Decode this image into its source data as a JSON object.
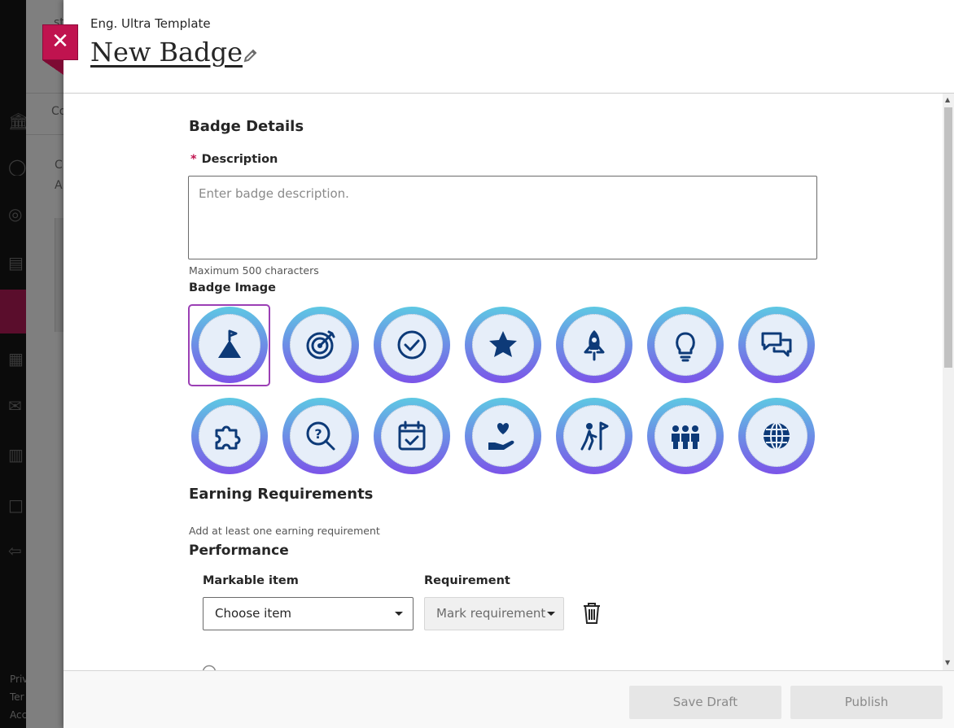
{
  "background": {
    "partial_texts": [
      "st",
      "Co",
      "C",
      "A"
    ],
    "footer_partial": [
      "Priv",
      "Ter",
      "Acc"
    ]
  },
  "panel": {
    "course_name": "Eng. Ultra Template",
    "title": "New Badge",
    "close_icon": "close-icon",
    "edit_icon": "pencil-icon"
  },
  "badge_details": {
    "heading": "Badge Details",
    "required_mark": "*",
    "description_label": "Description",
    "description_value": "",
    "description_placeholder": "Enter badge description.",
    "description_hint": "Maximum 500 characters",
    "image_label": "Badge Image",
    "selected_image": "mountain-flag",
    "images": [
      "mountain-flag",
      "target",
      "check-circle",
      "star",
      "rocket",
      "lightbulb",
      "chat-bubbles",
      "puzzle",
      "search-question",
      "calendar-check",
      "hand-heart",
      "person-flag",
      "group",
      "globe"
    ],
    "colors": {
      "ring_top": "#5ec8e3",
      "ring_bottom": "#7b54e8",
      "glyph": "#0d3a78",
      "selected_border": "#9b3fb5"
    }
  },
  "earning": {
    "heading": "Earning Requirements",
    "hint": "Add at least one earning requirement",
    "performance_heading": "Performance",
    "markable_label": "Markable item",
    "markable_value": "Choose item",
    "requirement_label": "Requirement",
    "requirement_value": "Mark requirement",
    "delete_icon": "trash-icon"
  },
  "footer": {
    "save_draft": "Save Draft",
    "publish": "Publish"
  },
  "accent": "#c0134f"
}
